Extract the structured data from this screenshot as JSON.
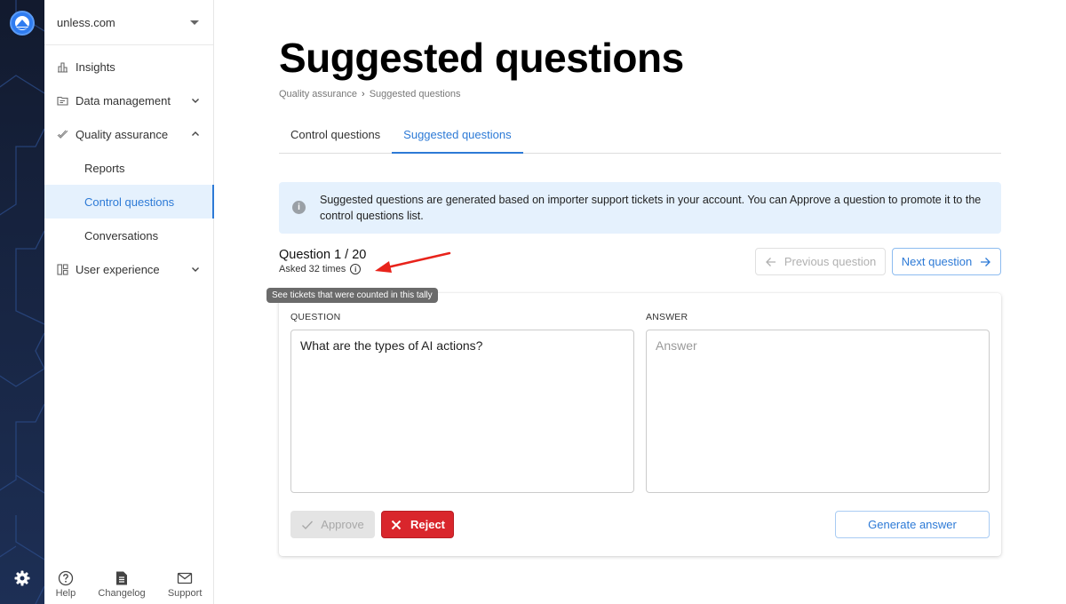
{
  "sidebar": {
    "org_name": "unless.com",
    "items": [
      {
        "label": "Insights",
        "icon": "bar-chart-icon"
      },
      {
        "label": "Data management",
        "icon": "folder-icon",
        "expanded": false
      },
      {
        "label": "Quality assurance",
        "icon": "check-icon",
        "expanded": true
      },
      {
        "label": "Reports"
      },
      {
        "label": "Control questions",
        "active": true
      },
      {
        "label": "Conversations"
      },
      {
        "label": "User experience",
        "icon": "layout-icon",
        "expanded": false
      }
    ],
    "footer": [
      {
        "label": "Help",
        "icon": "help-icon"
      },
      {
        "label": "Changelog",
        "icon": "document-icon"
      },
      {
        "label": "Support",
        "icon": "mail-icon"
      }
    ]
  },
  "page": {
    "title": "Suggested questions",
    "breadcrumb": [
      "Quality assurance",
      "Suggested questions"
    ],
    "breadcrumb_sep": "›",
    "tabs": [
      {
        "label": "Control questions",
        "active": false
      },
      {
        "label": "Suggested questions",
        "active": true
      }
    ],
    "banner": "Suggested questions are generated based on importer support tickets in your account. You can Approve a question to promote it to the control questions list.",
    "banner_icon": "i"
  },
  "question": {
    "counter": "Question 1 / 20",
    "asked": "Asked 32 times",
    "info_icon": "i",
    "tooltip": "See tickets that were counted in this tally",
    "prev_label": "Previous question",
    "next_label": "Next question",
    "question_label": "QUESTION",
    "question_value": "What are the types of AI actions?",
    "answer_label": "ANSWER",
    "answer_placeholder": "Answer",
    "answer_value": "",
    "approve_label": "Approve",
    "reject_label": "Reject",
    "generate_label": "Generate answer"
  },
  "colors": {
    "accent": "#2d7ad6",
    "reject": "#d9262c",
    "banner_bg": "#e5f1fd",
    "rail_bg": "#172441",
    "annotation_arrow": "#e8231b"
  }
}
